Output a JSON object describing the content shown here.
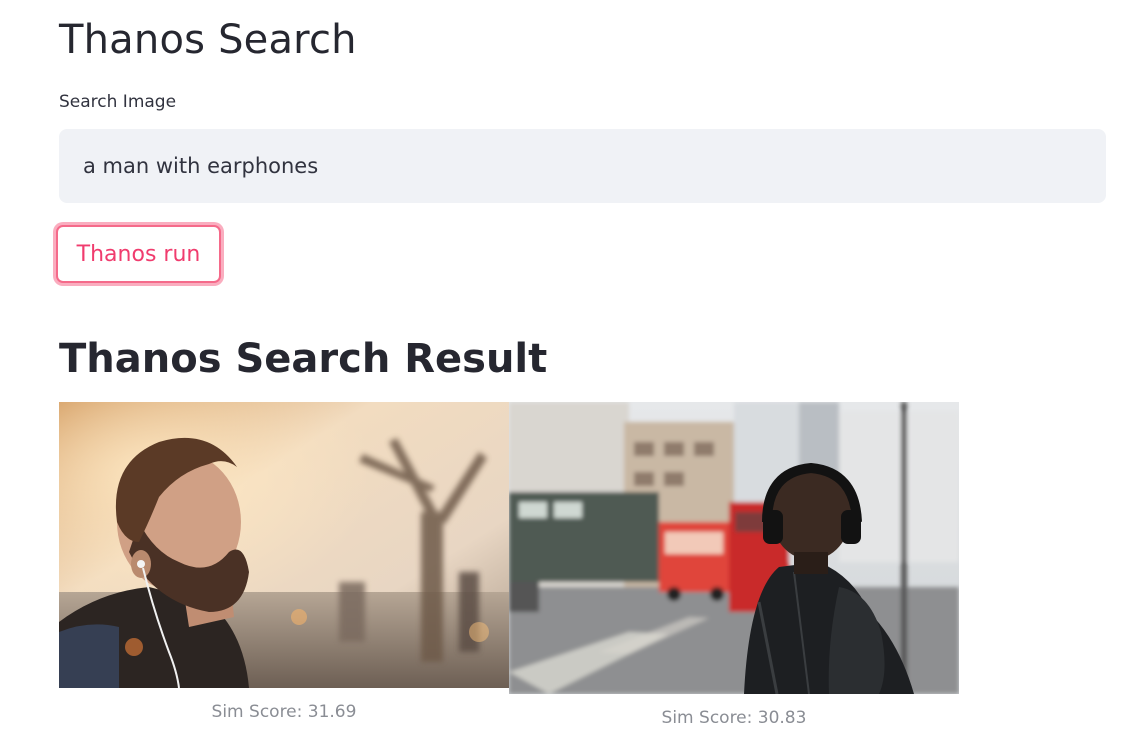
{
  "header": {
    "title": "Thanos Search"
  },
  "search": {
    "label": "Search Image",
    "value": "a man with earphones"
  },
  "actions": {
    "run_label": "Thanos run"
  },
  "results": {
    "title": "Thanos Search Result",
    "items": [
      {
        "caption": "Sim Score: 31.69"
      },
      {
        "caption": "Sim Score: 30.83"
      }
    ]
  },
  "colors": {
    "accent": "#f03c6e",
    "input_background": "#f0f2f6",
    "text": "#262730",
    "caption": "#8a8d94"
  }
}
